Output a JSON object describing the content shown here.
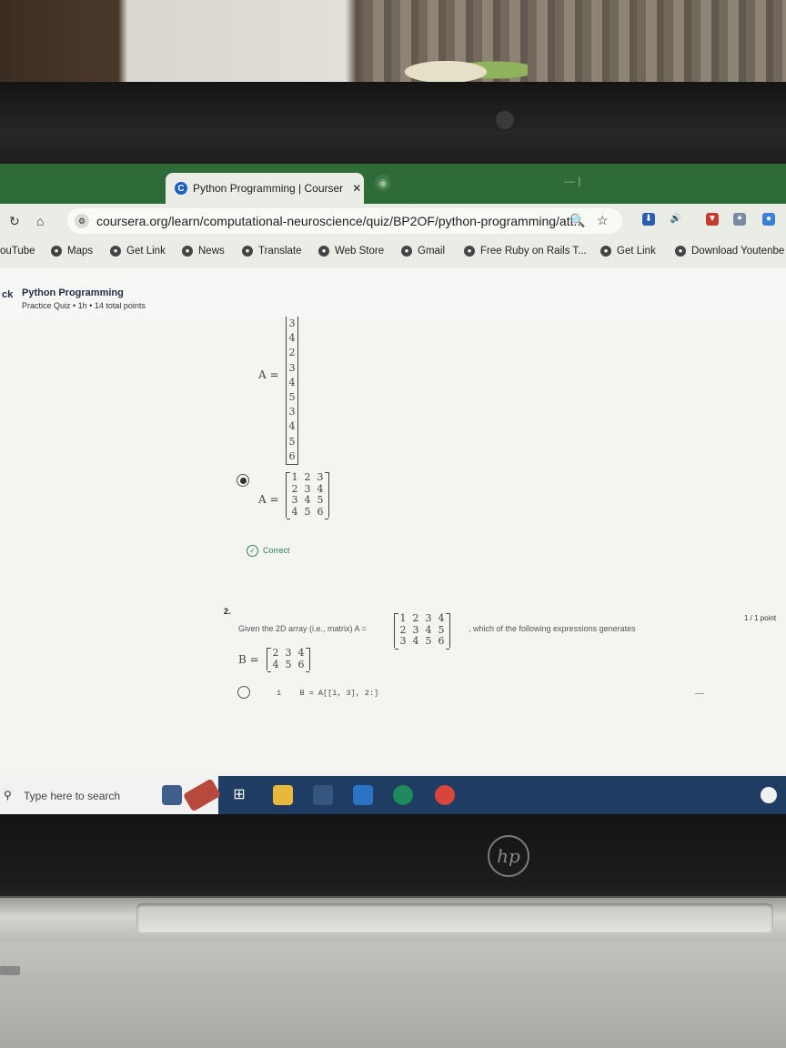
{
  "browser": {
    "faded_left_tab": "",
    "active_tab": {
      "favicon": "C",
      "title": "Python Programming | Courser",
      "close": "✕"
    },
    "faded_right_tab": "",
    "url": "coursera.org/learn/computational-neuroscience/quiz/BP2OF/python-programming/att..."
  },
  "bookmarks": [
    {
      "label": "ouTube"
    },
    {
      "label": "Maps"
    },
    {
      "label": "Get Link"
    },
    {
      "label": "News"
    },
    {
      "label": "Translate"
    },
    {
      "label": "Web Store"
    },
    {
      "label": "Gmail"
    },
    {
      "label": "Free Ruby on Rails T..."
    },
    {
      "label": "Get Link"
    },
    {
      "label": "Download Youtenbe"
    }
  ],
  "quiz": {
    "back_label": "ck",
    "title": "Python Programming",
    "meta": "Practice Quiz • 1h • 14 total points"
  },
  "q1": {
    "option_prev": {
      "label": "A =",
      "column_values": [
        "3",
        "4",
        "2",
        "3",
        "4",
        "5",
        "3",
        "4",
        "5",
        "6"
      ]
    },
    "option_selected": {
      "label": "A =",
      "matrix": [
        [
          "1",
          "2",
          "3"
        ],
        [
          "2",
          "3",
          "4"
        ],
        [
          "3",
          "4",
          "5"
        ],
        [
          "4",
          "5",
          "6"
        ]
      ],
      "selected": true
    },
    "feedback": "Correct"
  },
  "q2": {
    "number": "2.",
    "text_before": "Given the 2D array (i.e., matrix) A =",
    "matrix_A": [
      [
        "1",
        "2",
        "3",
        "4"
      ],
      [
        "2",
        "3",
        "4",
        "5"
      ],
      [
        "3",
        "4",
        "5",
        "6"
      ]
    ],
    "text_after": ", which of the following expressions generates",
    "points": "1 / 1 point",
    "b_label": "B =",
    "matrix_B": [
      [
        "2",
        "3",
        "4"
      ],
      [
        "4",
        "5",
        "6"
      ]
    ],
    "option1": {
      "line_no": "1",
      "code": "B = A[[1, 3], 2:]"
    }
  },
  "taskbar": {
    "search_placeholder": "Type here to search"
  },
  "laptop": {
    "brand": "hp"
  }
}
